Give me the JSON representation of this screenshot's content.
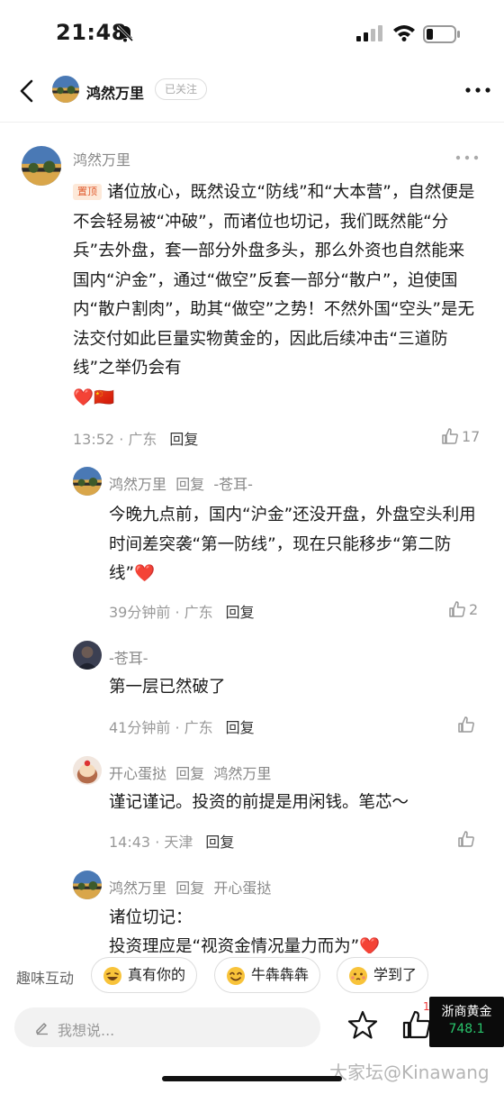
{
  "status": {
    "time": "21:48"
  },
  "nav": {
    "title": "鸿然万里",
    "follow_label": "已关注"
  },
  "main_comment": {
    "author": "鸿然万里",
    "pin_label": "置顶",
    "text": "诸位放心，既然设立“防线”和“大本营”，自然便是不会轻易被“冲破”，而诸位也切记，我们既然能“分兵”去外盘，套一部分外盘多头，那么外资也自然能来国内“沪金”，通过“做空”反套一部分“散户”，迫使国内“散户割肉”，助其“做空”之势！不然外国“空头”是无法交付如此巨量实物黄金的，因此后续冲击“三道防线”之举仍会有",
    "emojis": "❤️🇨🇳",
    "time": "13:52 · 广东",
    "reply_label": "回复",
    "likes": "17"
  },
  "replies": [
    {
      "author": "鸿然万里",
      "reply_word": "回复",
      "target": "-苍耳-",
      "text": "今晚九点前，国内“沪金”还没开盘，外盘空头利用时间差突袭“第一防线”，现在只能移步“第二防线”❤️",
      "time": "39分钟前 · 广东",
      "reply_label": "回复",
      "likes": "2"
    },
    {
      "author": "-苍耳-",
      "reply_word": "",
      "target": "",
      "text": "第一层已然破了",
      "time": "41分钟前 · 广东",
      "reply_label": "回复",
      "likes": ""
    },
    {
      "author": "开心蛋挞",
      "reply_word": "回复",
      "target": "鸿然万里",
      "text": "谨记谨记。投资的前提是用闲钱。笔芯～",
      "time": "14:43 · 天津",
      "reply_label": "回复",
      "likes": ""
    },
    {
      "author": "鸿然万里",
      "reply_word": "回复",
      "target": "开心蛋挞",
      "text": "诸位切记：",
      "text2": "投资理应是“视资金情况量力而为”❤️",
      "time": "",
      "reply_label": "",
      "likes": ""
    }
  ],
  "reactions": {
    "label": "趣味互动",
    "chips": [
      {
        "label": "真有你的",
        "icon": "laughing-emoji-icon"
      },
      {
        "label": "牛犇犇犇",
        "icon": "smiling-emoji-icon"
      },
      {
        "label": "学到了",
        "icon": "shy-emoji-icon"
      }
    ]
  },
  "bottom": {
    "input_placeholder": "我想说...",
    "like_count": "1",
    "gold_title": "浙商黄金",
    "gold_value": "748.1"
  },
  "watermark": "大家坛@Kinawang",
  "colors": {
    "pin_bg": "#fde9d9",
    "pin_text": "#e05b2e",
    "gold_green": "#29c46b"
  }
}
